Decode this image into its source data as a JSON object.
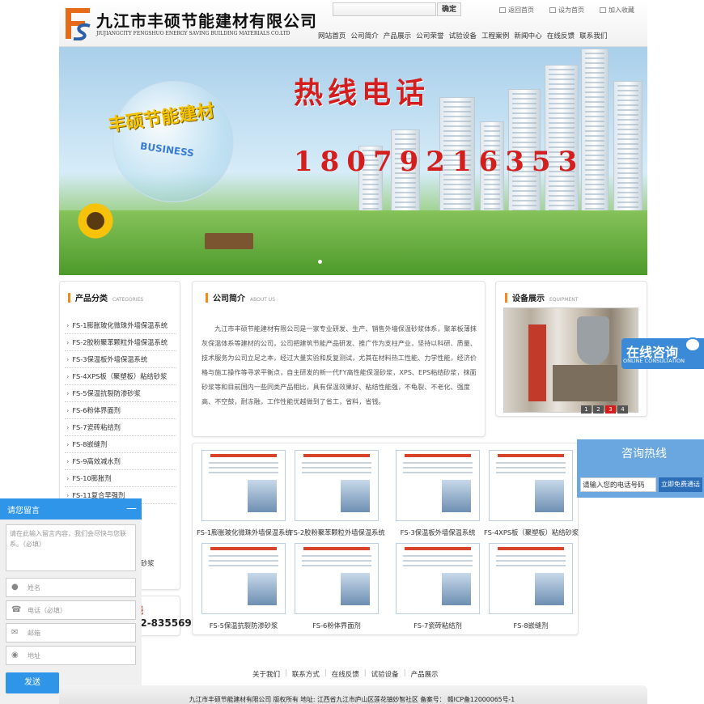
{
  "header": {
    "company_cn": "九江市丰硕节能建材有限公司",
    "company_en": "JIUJIANGCITY FENGSHUO ENERGY SAVING BUILDING MATERIALS CO.LTD",
    "logo_text": "FS",
    "search_placeholder": "",
    "confirm_label": "确定",
    "top_links": [
      "返回首页",
      "设为首页",
      "加入收藏"
    ]
  },
  "nav": {
    "items": [
      "网站首页",
      "公司简介",
      "产品展示",
      "公司荣誉",
      "试验设备",
      "工程案例",
      "新闻中心",
      "在线反馈",
      "联系我们"
    ]
  },
  "banner": {
    "hotline_title": "热线电话",
    "phone": "18079216353",
    "globe_text": "丰硕节能建材",
    "globe_business": "BUSINESS"
  },
  "categories": {
    "title": "产品分类",
    "subtitle": "CATEGORIES",
    "items": [
      "FS-1膨胀玻化微珠外墙保温系统",
      "FS-2胶粉聚苯颗粒外墙保温系统",
      "FS-3保温板外墙保温系统",
      "FS-4XPS板（聚塑板）粘结砂浆",
      "FS-5保温抗裂防渗砂浆",
      "FS-6粉体界面剂",
      "FS-7瓷砖粘结剂",
      "FS-8嵌缝剂",
      "FS-9高效减水剂",
      "FS-10膨胀剂",
      "FS-11复合早强剂"
    ],
    "partial_item": "砂浆"
  },
  "side_hotline": {
    "label": "线",
    "number": "92-8355698"
  },
  "about": {
    "title": "公司简介",
    "subtitle": "ABOUT US",
    "text": "九江市丰硕节能建材有限公司是一家专业研发、生产、销售外墙保温砂浆体系，聚苯板薄抹灰保温体系等建材的公司，公司把建筑节能产品研发、推广作为支柱产业，坚持以科研、质量、技术服务为公司立足之本，经过大量实验和反复测试，尤其在材料热工性能、力学性能，经济价格与施工操作等寻求平衡点，自主研发的新一代FY高性能保温砂浆，XPS、EPS粘结砂浆，抹面砂浆等和目前国内一些同类产品相比，具有保温效果好、粘结性能强，不龟裂、不老化、强度高、不空鼓，耐冻融，工作性能优越做到了省工，省料，省钱。"
  },
  "equipment": {
    "title": "设备展示",
    "subtitle": "EQUIPMENT",
    "pages": [
      "1",
      "2",
      "3",
      "4"
    ],
    "active_page": "3"
  },
  "gallery": {
    "items": [
      "FS-1膨胀玻化微珠外墙保温系统",
      "FS-2胶粉聚苯颗粒外墙保温系统",
      "FS-3保温板外墙保温系统",
      "FS-4XPS板（聚塑板）粘结砂浆",
      "FS-5保温抗裂防渗砂浆",
      "FS-6粉体界面剂",
      "FS-7瓷砖粘结剂",
      "FS-8嵌缝剂"
    ]
  },
  "float_consult": {
    "cn": "在线咨询",
    "en": "ONLINE CONSULTATION"
  },
  "hotline_box": {
    "title": "咨询热线",
    "input_value": "请输入您的电话号码",
    "button_label": "立即免费通话"
  },
  "message": {
    "title": "请您留言",
    "minimize": "—",
    "textarea_placeholder": "请在此输入留言内容，我们会尽快与您联系。（必填）",
    "name_placeholder": "姓名",
    "phone_placeholder": "电话（必填）",
    "email_placeholder": "邮箱",
    "address_placeholder": "地址",
    "send_label": "发送"
  },
  "footer": {
    "links": [
      "关于我们",
      "联系方式",
      "在线反馈",
      "试验设备",
      "产品展示"
    ],
    "copyright": "九江市丰硕节能建材有限公司 版权所有 地址: 江西省九江市庐山区莲花镇妙智社区 备案号： 赣ICP备12000065号-1"
  },
  "colors": {
    "accent_orange": "#f08a1c",
    "hotline_red": "#d41e1e",
    "consult_blue": "#2e95e8"
  }
}
